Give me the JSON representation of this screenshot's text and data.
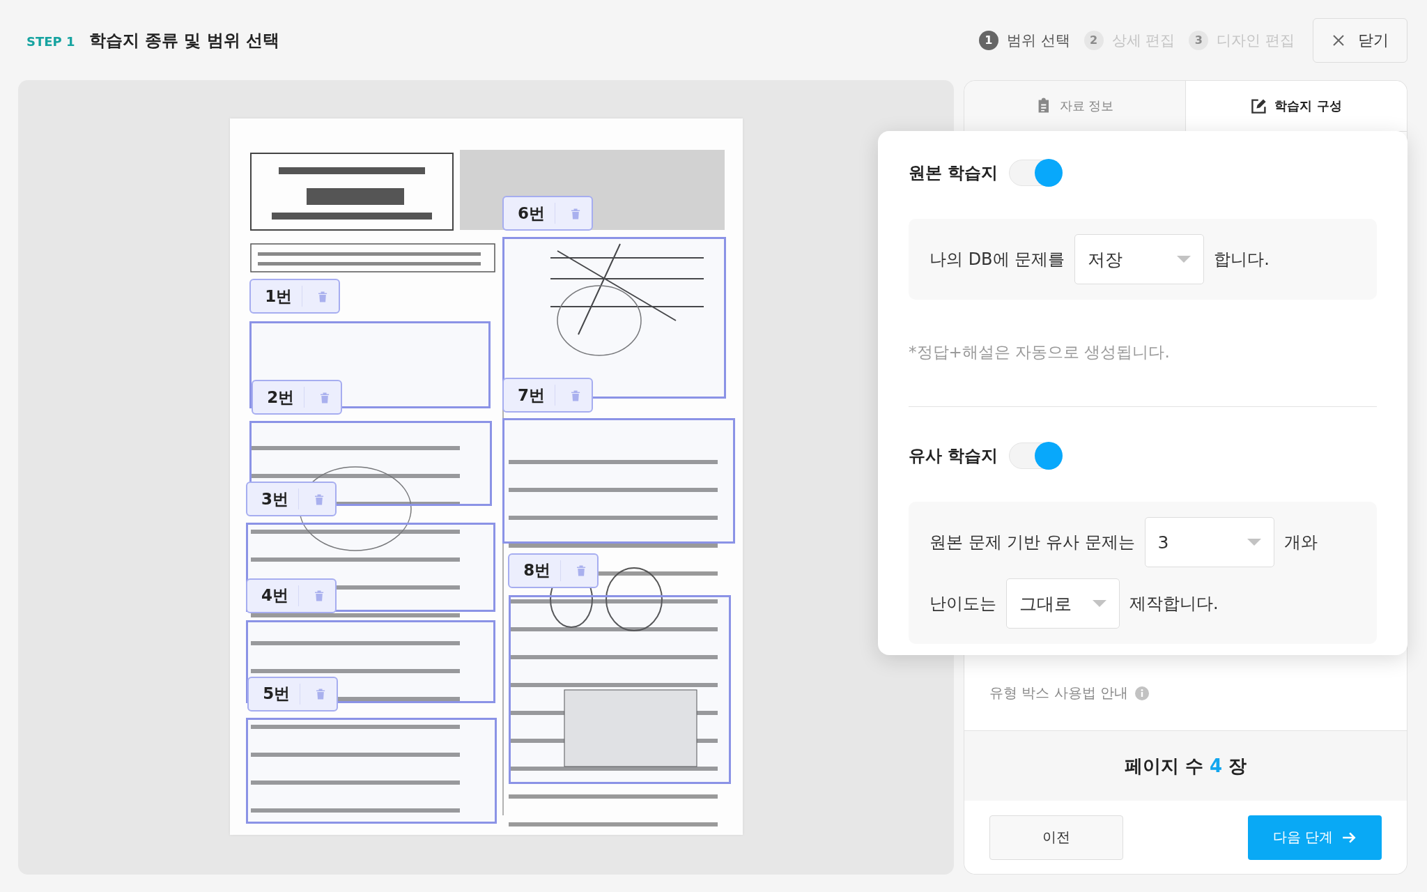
{
  "header": {
    "step": "STEP 1",
    "title": "학습지 종류 및 범위 선택"
  },
  "steps": [
    {
      "number": "1",
      "label": "범위 선택",
      "selected": true
    },
    {
      "number": "2",
      "label": "상세 편집",
      "selected": false
    },
    {
      "number": "3",
      "label": "디자인 편집",
      "selected": false
    }
  ],
  "close_button": {
    "label": "닫기"
  },
  "document": {
    "kind": "picture",
    "regions": [
      {
        "label": "1번"
      },
      {
        "label": "2번"
      },
      {
        "label": "3번"
      },
      {
        "label": "4번"
      },
      {
        "label": "5번"
      },
      {
        "label": "6번"
      },
      {
        "label": "7번"
      },
      {
        "label": "8번"
      }
    ]
  },
  "tabs": [
    {
      "label": "자료 정보",
      "selected": false
    },
    {
      "label": "학습지 구성",
      "selected": true
    }
  ],
  "popover": {
    "sections": [
      {
        "title": "원본 학습지",
        "on": true,
        "lines": [
          {
            "parts": [
              {
                "kind": "text",
                "text": "나의 DB에 문제를"
              },
              {
                "kind": "select",
                "value": "저장"
              },
              {
                "kind": "text",
                "text": "합니다."
              }
            ]
          }
        ],
        "note": "*정답+해설은 자동으로 생성됩니다."
      },
      {
        "title": "유사 학습지",
        "on": true,
        "lines": [
          {
            "parts": [
              {
                "kind": "text",
                "text": "원본 문제 기반 유사 문제는"
              },
              {
                "kind": "select",
                "value": "3"
              },
              {
                "kind": "text",
                "text": "개와"
              }
            ]
          },
          {
            "parts": [
              {
                "kind": "text",
                "text": "난이도는"
              },
              {
                "kind": "select",
                "value": "그대로"
              },
              {
                "kind": "text",
                "text": "제작합니다."
              }
            ]
          }
        ]
      }
    ]
  },
  "guide_link": "유형 박스 사용법 안내",
  "page_count": {
    "label": "페이지 수",
    "value": "4",
    "unit": "장"
  },
  "buttons": {
    "previous": "이전",
    "next": "다음 단계"
  }
}
